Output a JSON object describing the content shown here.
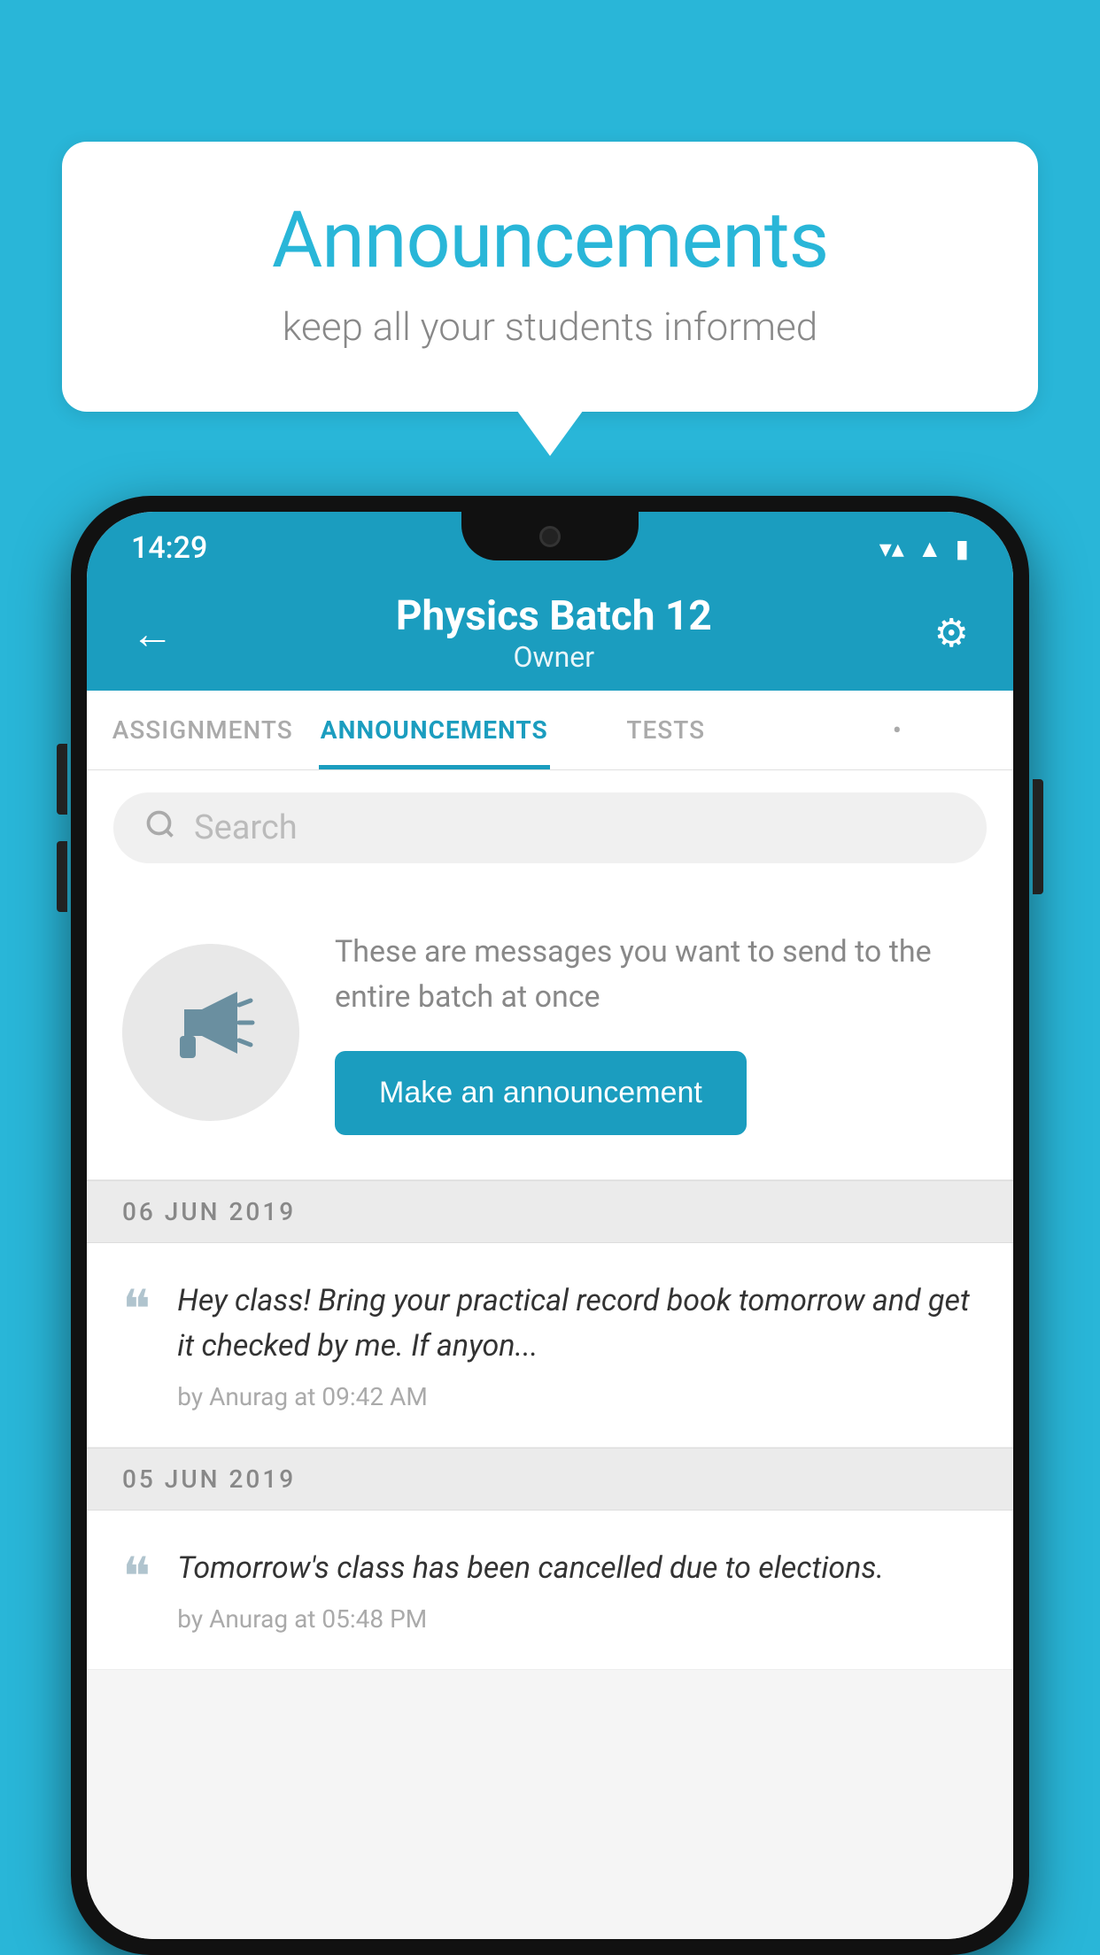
{
  "background_color": "#29b6d8",
  "speech_bubble": {
    "title": "Announcements",
    "subtitle": "keep all your students informed"
  },
  "phone": {
    "status_bar": {
      "time": "14:29",
      "icons": [
        "wifi",
        "signal",
        "battery"
      ]
    },
    "header": {
      "title": "Physics Batch 12",
      "subtitle": "Owner",
      "back_label": "←",
      "gear_label": "⚙"
    },
    "tabs": [
      {
        "label": "ASSIGNMENTS",
        "active": false
      },
      {
        "label": "ANNOUNCEMENTS",
        "active": true
      },
      {
        "label": "TESTS",
        "active": false
      },
      {
        "label": "•",
        "active": false
      }
    ],
    "search": {
      "placeholder": "Search"
    },
    "promo": {
      "description": "These are messages you want to send to the entire batch at once",
      "button_label": "Make an announcement"
    },
    "announcements": [
      {
        "date": "06  JUN  2019",
        "text": "Hey class! Bring your practical record book tomorrow and get it checked by me. If anyon...",
        "meta": "by Anurag at 09:42 AM"
      },
      {
        "date": "05  JUN  2019",
        "text": "Tomorrow's class has been cancelled due to elections.",
        "meta": "by Anurag at 05:48 PM"
      }
    ]
  }
}
